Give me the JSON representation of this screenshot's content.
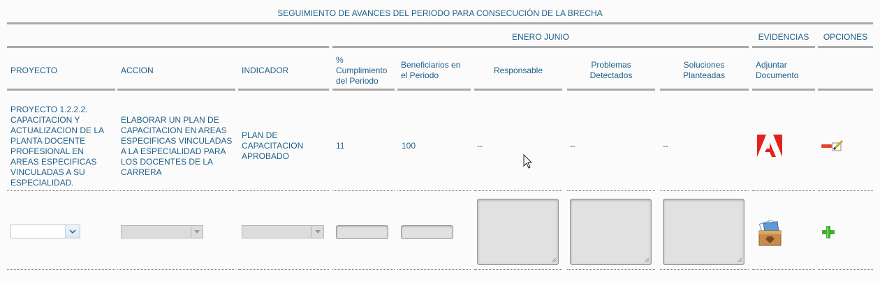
{
  "section_title": "SEGUIMIENTO DE AVANCES DEL PERIODO PARA CONSECUCIÓN DE LA BRECHA",
  "group_headers": {
    "period": "ENERO JUNIO",
    "evidence": "EVIDENCIAS",
    "options": "OPCIONES"
  },
  "columns": {
    "project": "PROYECTO",
    "action": "ACCION",
    "indicator": "INDICADOR",
    "compliance_line1": "%",
    "compliance_line2": "Cumplimiento",
    "compliance_line3": "del Periodo",
    "beneficiaries_line1": "Beneficiarios en",
    "beneficiaries_line2": "el Periodo",
    "responsible": "Responsable",
    "problems_line1": "Problemas",
    "problems_line2": "Detectados",
    "solutions_line1": "Soluciones",
    "solutions_line2": "Planteadas",
    "attach_line1": "Adjuntar",
    "attach_line2": "Documento"
  },
  "row": {
    "project_lines": [
      "PROYECTO 1.2.2.2.",
      "CAPACITACION Y",
      "ACTUALIZACION DE LA",
      "PLANTA DOCENTE",
      "PROFESIONAL EN",
      "AREAS ESPECIFICAS",
      "VINCULADAS A SU",
      "ESPECIALIDAD."
    ],
    "action_lines": [
      "ELABORAR UN PLAN DE",
      "CAPACITACION EN AREAS",
      "ESPECIFICAS VINCULADAS",
      "A LA ESPECIALIDAD PARA",
      "LOS DOCENTES DE LA",
      "CARRERA"
    ],
    "indicator_lines": [
      "PLAN DE",
      "CAPACITACION",
      "APROBADO"
    ],
    "compliance": "11",
    "beneficiaries": "100",
    "responsible": "--",
    "problems": "--",
    "solutions": "--",
    "document_icon": "adobe-pdf-icon",
    "options_icon": "remove-edit-icon"
  },
  "new_row": {
    "project_value": "",
    "action_value": "",
    "indicator_value": "",
    "compliance_value": "",
    "beneficiaries_value": "",
    "responsible_value": "",
    "problems_value": "",
    "solutions_value": "",
    "upload_icon": "upload-box-icon",
    "add_icon": "plus-icon"
  },
  "colors": {
    "text": "#1f5f8b",
    "rule": "#a9a9a9",
    "pdf_red": "#e2231a",
    "add_green": "#3fae29",
    "remove_red": "#e0452f"
  }
}
